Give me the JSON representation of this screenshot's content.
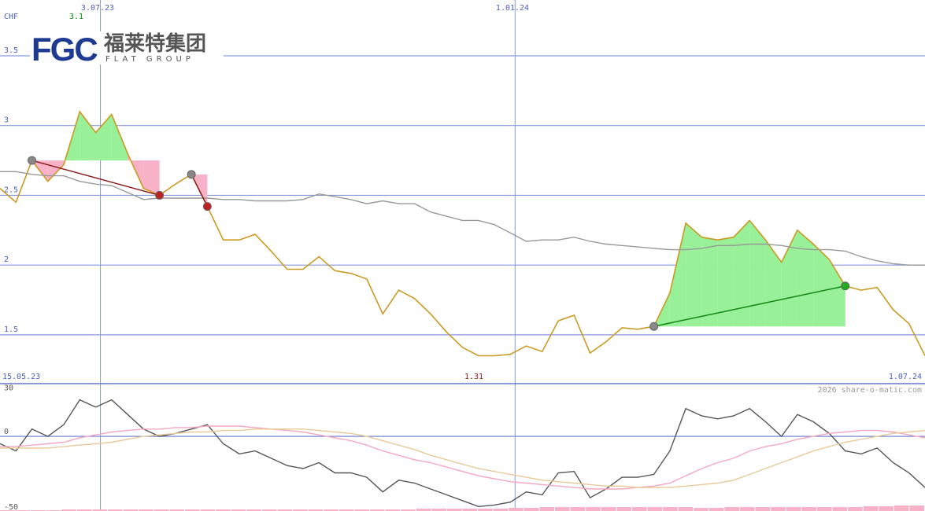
{
  "chart_data": [
    {
      "type": "line",
      "currency_label": "CHF",
      "date_labels": {
        "start": "15.05.23",
        "end": "1.07.24",
        "marker_1": "3.07.23",
        "marker_2": "1.01.24"
      },
      "marker_value_label": "3.1",
      "min_value_label": "1.31",
      "ylim": [
        1.15,
        3.9
      ],
      "y_ticks": [
        {
          "value": 3.5,
          "label": "3.5"
        },
        {
          "value": 3.0,
          "label": "3"
        },
        {
          "value": 2.5,
          "label": "2.5"
        },
        {
          "value": 2.0,
          "label": "2"
        },
        {
          "value": 1.5,
          "label": "1.5"
        }
      ],
      "grid": true,
      "x_count": 58,
      "marker_indices": [
        6,
        32
      ],
      "series": [
        {
          "color": "#cc9a22",
          "values": [
            2.55,
            2.45,
            2.75,
            2.6,
            2.72,
            3.1,
            2.95,
            3.08,
            2.8,
            2.55,
            2.5,
            2.58,
            2.65,
            2.42,
            2.18,
            2.18,
            2.22,
            2.1,
            1.97,
            1.97,
            2.06,
            1.96,
            1.94,
            1.9,
            1.65,
            1.82,
            1.76,
            1.65,
            1.52,
            1.41,
            1.35,
            1.35,
            1.36,
            1.42,
            1.38,
            1.6,
            1.64,
            1.37,
            1.45,
            1.55,
            1.54,
            1.56,
            1.8,
            2.3,
            2.2,
            2.18,
            2.2,
            2.32,
            2.18,
            2.02,
            2.25,
            2.15,
            2.04,
            1.85,
            1.82,
            1.84,
            1.68,
            1.58,
            1.35
          ]
        },
        {
          "color": "#999999",
          "values": [
            2.67,
            2.67,
            2.65,
            2.64,
            2.64,
            2.6,
            2.58,
            2.57,
            2.52,
            2.47,
            2.48,
            2.48,
            2.48,
            2.48,
            2.47,
            2.47,
            2.46,
            2.46,
            2.46,
            2.47,
            2.51,
            2.49,
            2.47,
            2.44,
            2.46,
            2.44,
            2.44,
            2.38,
            2.35,
            2.32,
            2.32,
            2.29,
            2.23,
            2.17,
            2.18,
            2.18,
            2.2,
            2.17,
            2.15,
            2.14,
            2.13,
            2.12,
            2.11,
            2.11,
            2.12,
            2.14,
            2.14,
            2.15,
            2.15,
            2.14,
            2.12,
            2.11,
            2.11,
            2.1,
            2.06,
            2.03,
            2.01,
            2.0,
            2.0
          ]
        }
      ],
      "signals": [
        {
          "type": "sell",
          "from_index": 2,
          "to_index": 10,
          "from_value": 2.75,
          "to_value": 2.5,
          "color": "#8b1a1a"
        },
        {
          "type": "sell",
          "from_index": 12,
          "to_index": 13,
          "from_value": 2.65,
          "to_value": 2.42,
          "color": "#8b1a1a"
        },
        {
          "type": "buy",
          "from_index": 41,
          "to_index": 53,
          "from_value": 1.56,
          "to_value": 1.85,
          "color": "#118811"
        }
      ]
    },
    {
      "type": "line",
      "ylim": [
        -50,
        35
      ],
      "y_ticks": [
        {
          "value": 30,
          "label": "30"
        },
        {
          "value": 0,
          "label": "0"
        },
        {
          "value": -50,
          "label": "-50"
        }
      ],
      "series": [
        {
          "color": "#555555",
          "values": [
            -5,
            -10,
            5,
            0,
            8,
            25,
            20,
            25,
            15,
            5,
            0,
            2,
            5,
            8,
            -5,
            -12,
            -10,
            -15,
            -20,
            -22,
            -18,
            -25,
            -25,
            -28,
            -38,
            -30,
            -32,
            -36,
            -40,
            -44,
            -48,
            -47,
            -45,
            -38,
            -40,
            -25,
            -24,
            -42,
            -36,
            -28,
            -28,
            -26,
            -10,
            19,
            14,
            12,
            14,
            19,
            10,
            0,
            15,
            10,
            2,
            -10,
            -12,
            -8,
            -18,
            -25,
            -35
          ]
        },
        {
          "color": "#f4a7c0",
          "values": [
            -7,
            -7,
            -6,
            -5,
            -4,
            -1,
            1,
            3,
            4,
            5,
            5,
            6,
            6,
            7,
            7,
            7,
            6,
            5,
            4,
            3,
            1,
            -1,
            -3,
            -6,
            -10,
            -13,
            -16,
            -18,
            -21,
            -24,
            -27,
            -29,
            -31,
            -32,
            -33,
            -34,
            -35,
            -36,
            -36,
            -36,
            -35,
            -34,
            -32,
            -27,
            -22,
            -18,
            -15,
            -10,
            -7,
            -5,
            -2,
            0,
            2,
            3,
            4,
            4,
            3,
            1,
            -1
          ]
        },
        {
          "color": "#e8c99a",
          "values": [
            -8,
            -8,
            -8,
            -8,
            -7,
            -6,
            -5,
            -4,
            -2,
            0,
            1,
            2,
            3,
            3,
            4,
            4,
            5,
            5,
            5,
            5,
            4,
            3,
            2,
            0,
            -3,
            -6,
            -9,
            -13,
            -16,
            -19,
            -22,
            -24,
            -26,
            -28,
            -30,
            -31,
            -32,
            -33,
            -34,
            -34,
            -35,
            -35,
            -35,
            -34,
            -33,
            -32,
            -30,
            -26,
            -22,
            -18,
            -14,
            -10,
            -7,
            -4,
            -2,
            0,
            2,
            3,
            4
          ]
        }
      ],
      "histogram_color": "#f7b2c8",
      "histogram_values": [
        1,
        1,
        1,
        1,
        2,
        2,
        2,
        2,
        2,
        2,
        2,
        2,
        2,
        2,
        2,
        2,
        2,
        2,
        2,
        2,
        2,
        2,
        2,
        2,
        2,
        2,
        2,
        3,
        3,
        3,
        3,
        3,
        3,
        4,
        4,
        5,
        5,
        5,
        5,
        5,
        5,
        5,
        5,
        5,
        5,
        4,
        4,
        5,
        5,
        5,
        5,
        5,
        5,
        5,
        5,
        5,
        6,
        6,
        7,
        7
      ]
    }
  ],
  "logo": {
    "mark": "FGC",
    "name_cn": "福莱特集团",
    "name_en": "FLAT GROUP",
    "color_blue": "#1f3a93",
    "color_green": "#7fb82a"
  },
  "copyright": "2026 share-o-matic.com"
}
